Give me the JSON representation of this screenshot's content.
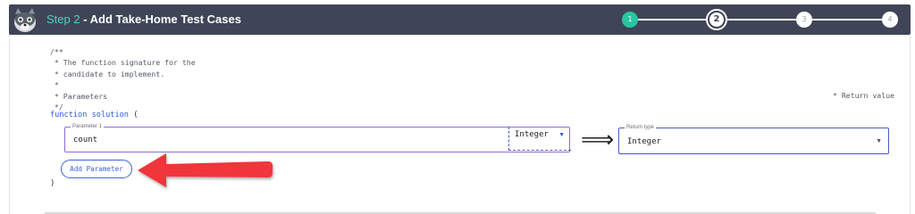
{
  "header": {
    "step_prefix": "Step 2",
    "title": " - Add Take-Home Test Cases",
    "colors": {
      "bar": "#3f4556",
      "accent": "#26c6a2"
    }
  },
  "stepper": {
    "steps": [
      {
        "label": "1",
        "state": "done"
      },
      {
        "label": "2",
        "state": "current"
      },
      {
        "label": "3",
        "state": "pending"
      },
      {
        "label": "4",
        "state": "pending"
      }
    ]
  },
  "code_comment": "/**\n * The function signature for the\n * candidate to implement.\n *\n * Parameters\n */",
  "return_comment": "* Return value",
  "function_line": {
    "keyword": "function",
    "name": "solution",
    "open_paren": "("
  },
  "parameter": {
    "legend": "Parameter 1",
    "value": "count",
    "type": "Integer"
  },
  "return_type": {
    "legend": "Return type",
    "value": "Integer"
  },
  "add_parameter_label": "Add Parameter",
  "close_paren": ")",
  "icons": {
    "logo": "raccoon-logo-icon",
    "param_type_dropdown": "caret-down-icon",
    "return_dropdown": "caret-down-icon",
    "mapping_arrow": "double-arrow-right-icon",
    "annotation": "red-arrow-left-icon"
  }
}
